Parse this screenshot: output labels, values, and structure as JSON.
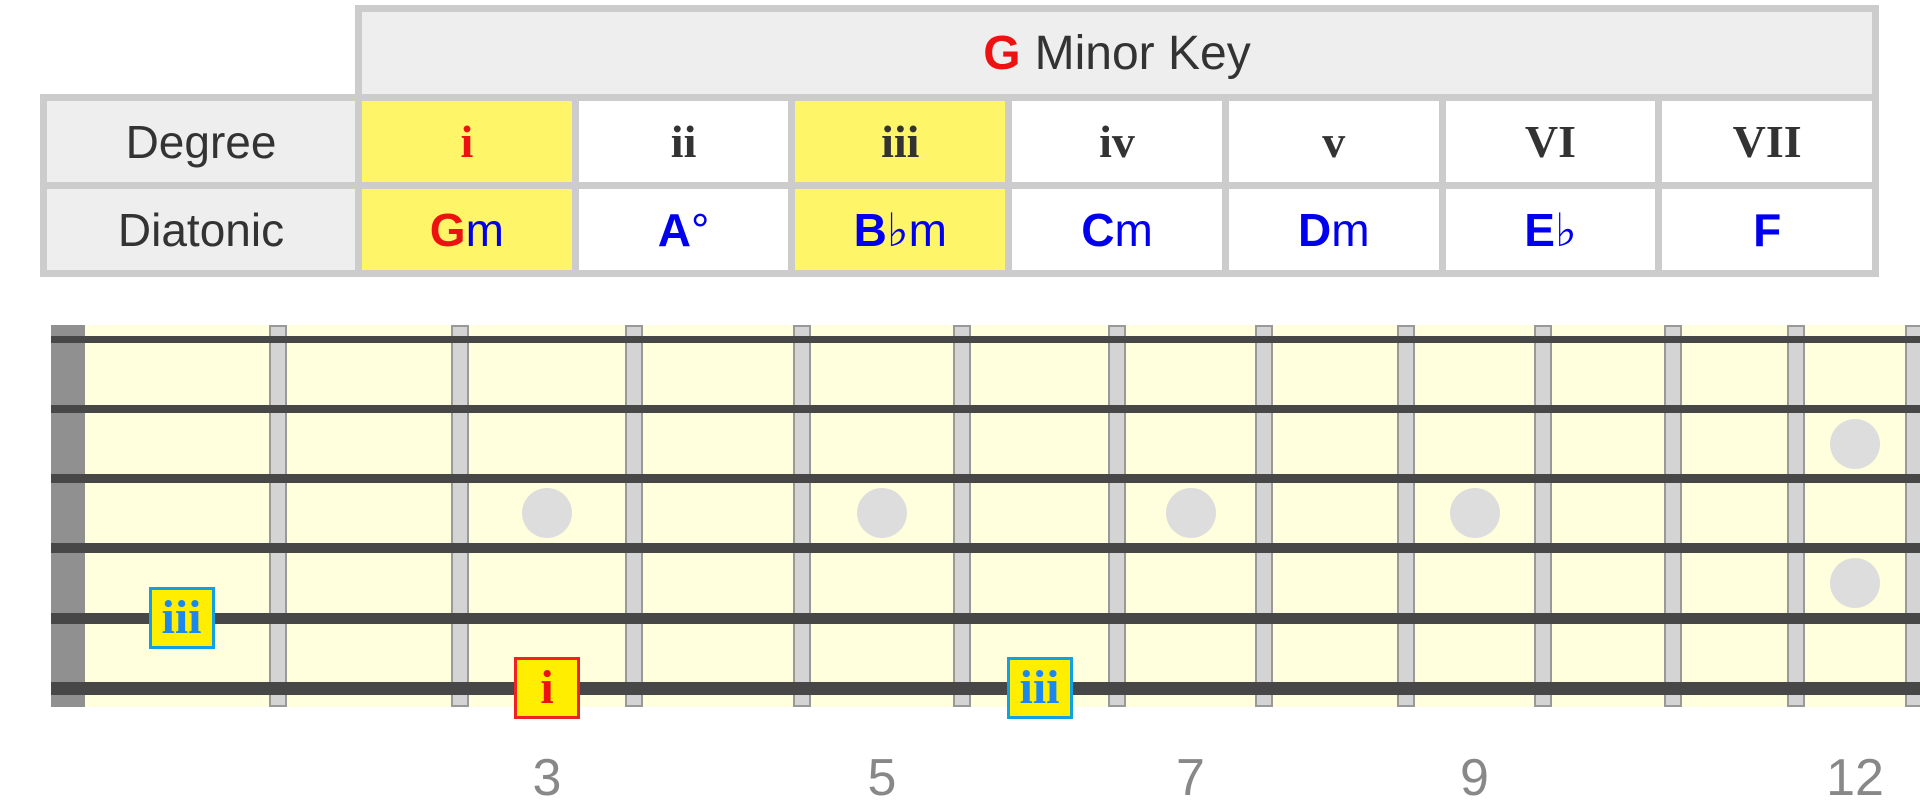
{
  "key_table": {
    "title_root": "G",
    "title_rest": "Minor Key",
    "row_labels": {
      "degree": "Degree",
      "diatonic": "Diatonic"
    },
    "columns": [
      {
        "degree": "i",
        "chord_root": "G",
        "chord_suffix": "m",
        "highlighted": true,
        "is_tonic": true
      },
      {
        "degree": "ii",
        "chord_root": "A",
        "chord_suffix": "°",
        "highlighted": false,
        "is_tonic": false
      },
      {
        "degree": "iii",
        "chord_root": "B",
        "chord_suffix": "♭m",
        "highlighted": true,
        "is_tonic": false
      },
      {
        "degree": "iv",
        "chord_root": "C",
        "chord_suffix": "m",
        "highlighted": false,
        "is_tonic": false
      },
      {
        "degree": "v",
        "chord_root": "D",
        "chord_suffix": "m",
        "highlighted": false,
        "is_tonic": false
      },
      {
        "degree": "VI",
        "chord_root": "E",
        "chord_suffix": "♭",
        "highlighted": false,
        "is_tonic": false
      },
      {
        "degree": "VII",
        "chord_root": "F",
        "chord_suffix": "",
        "highlighted": false,
        "is_tonic": false
      }
    ]
  },
  "fretboard": {
    "strings": [
      "e",
      "B",
      "G",
      "D",
      "A",
      "E"
    ],
    "fret_count": 12,
    "inlay_frets": [
      3,
      5,
      7,
      9
    ],
    "double_inlay_frets": [
      12
    ],
    "fret_numbers": [
      "3",
      "5",
      "7",
      "9",
      "12"
    ],
    "markers": [
      {
        "label": "iii",
        "string": "A",
        "fret": 1,
        "type": "degree"
      },
      {
        "label": "i",
        "string": "E",
        "fret": 3,
        "type": "root"
      },
      {
        "label": "iii",
        "string": "E",
        "fret": 6,
        "type": "degree"
      }
    ]
  },
  "colors": {
    "root": "#ee1111",
    "chord": "#0000ee",
    "highlight": "#fff568",
    "marker_fill": "#ffee00",
    "marker_degree": "#1a88ee"
  }
}
